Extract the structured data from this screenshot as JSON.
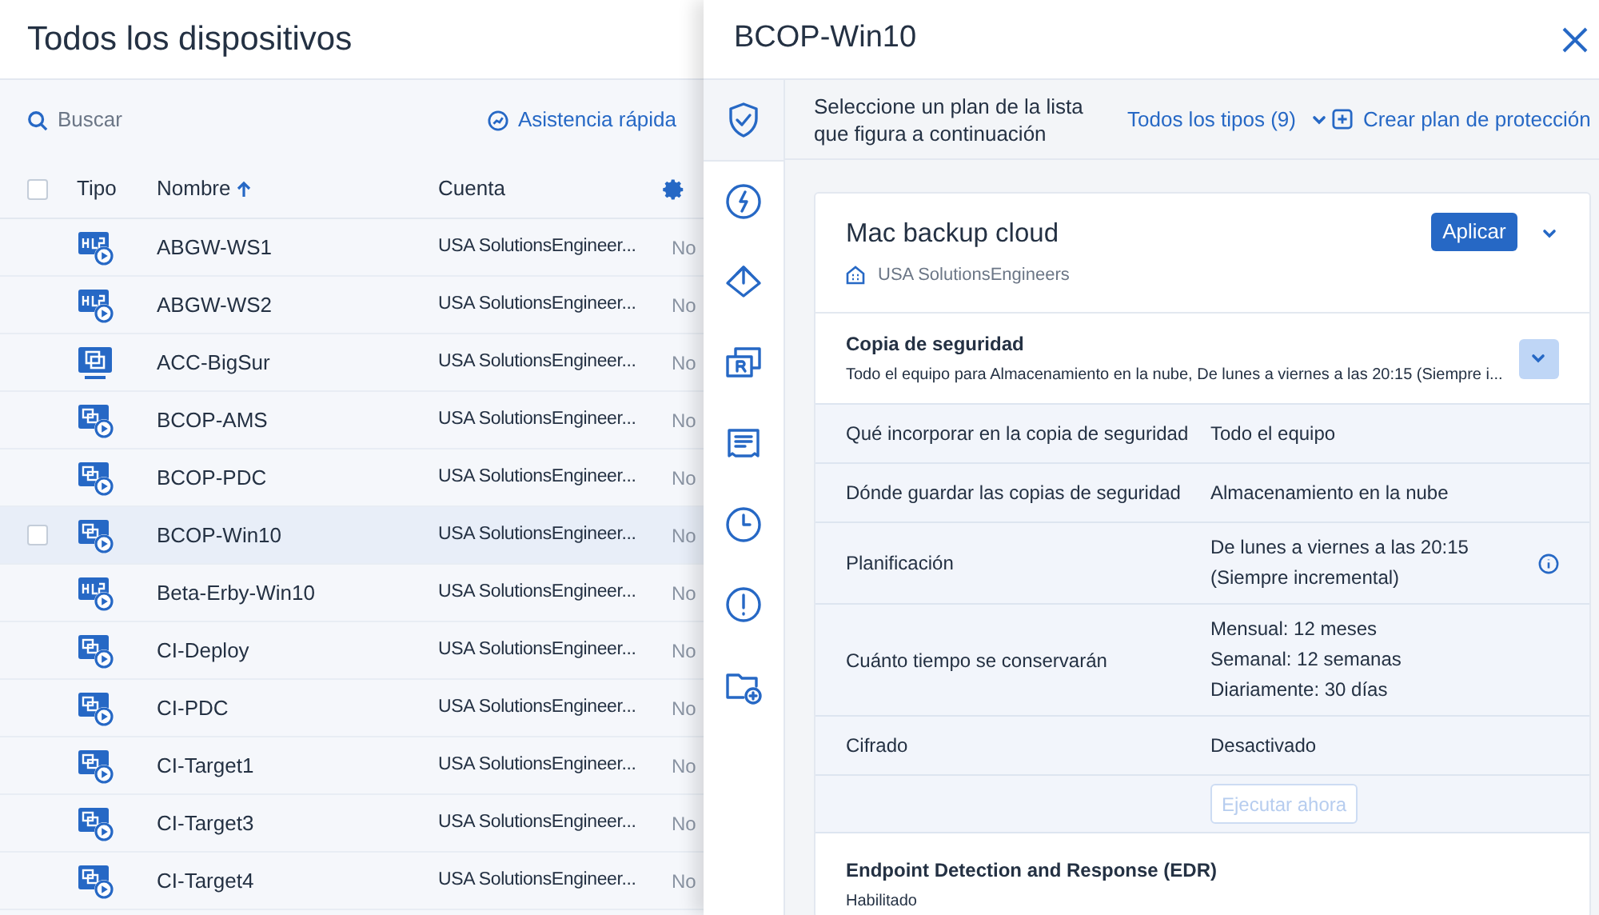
{
  "devices": {
    "title": "Todos los dispositivos",
    "search": {
      "placeholder": "Buscar"
    },
    "quick_assist": "Asistencia rápida",
    "table": {
      "select_all_checked": false,
      "columns": [
        {
          "label": "Tipo",
          "sorted": false
        },
        {
          "label": "Nombre",
          "sorted": true
        },
        {
          "label": "Cuenta",
          "sorted": false
        }
      ],
      "rows": [
        {
          "kind": "hc",
          "name": "ABGW-WS1",
          "account": "USA SolutionsEngineer...",
          "column_4": "No",
          "selected": false
        },
        {
          "kind": "hc",
          "name": "ABGW-WS2",
          "account": "USA SolutionsEngineer...",
          "column_4": "No",
          "selected": false
        },
        {
          "kind": "vm",
          "name": "ACC-BigSur",
          "account": "USA SolutionsEngineer...",
          "column_4": "No",
          "selected": false
        },
        {
          "kind": "multi",
          "name": "BCOP-AMS",
          "account": "USA SolutionsEngineer...",
          "column_4": "No",
          "selected": false
        },
        {
          "kind": "multi",
          "name": "BCOP-PDC",
          "account": "USA SolutionsEngineer...",
          "column_4": "No",
          "selected": false
        },
        {
          "kind": "multi",
          "name": "BCOP-Win10",
          "account": "USA SolutionsEngineer...",
          "column_4": "No",
          "selected": true
        },
        {
          "kind": "hc",
          "name": "Beta-Erby-Win10",
          "account": "USA SolutionsEngineer...",
          "column_4": "No",
          "selected": false
        },
        {
          "kind": "multi",
          "name": "CI-Deploy",
          "account": "USA SolutionsEngineer...",
          "column_4": "No",
          "selected": false
        },
        {
          "kind": "multi",
          "name": "CI-PDC",
          "account": "USA SolutionsEngineer...",
          "column_4": "No",
          "selected": false
        },
        {
          "kind": "multi",
          "name": "CI-Target1",
          "account": "USA SolutionsEngineer...",
          "column_4": "No",
          "selected": false
        },
        {
          "kind": "multi",
          "name": "CI-Target3",
          "account": "USA SolutionsEngineer...",
          "column_4": "No",
          "selected": false
        },
        {
          "kind": "multi",
          "name": "CI-Target4",
          "account": "USA SolutionsEngineer...",
          "column_4": "No",
          "selected": false
        }
      ]
    }
  },
  "panel": {
    "title": "BCOP-Win10",
    "nav": [
      {
        "kind": "shield",
        "selected": true
      },
      {
        "kind": "bolt",
        "selected": false
      },
      {
        "kind": "upload",
        "selected": false
      },
      {
        "kind": "replica",
        "selected": false
      },
      {
        "kind": "report",
        "selected": false
      },
      {
        "kind": "clock",
        "selected": false
      },
      {
        "kind": "alert",
        "selected": false
      },
      {
        "kind": "folder",
        "selected": false
      }
    ],
    "prompt": "Seleccione un plan de la lista que figura a continuación",
    "filter": "Todos los tipos (9)",
    "create": "Crear plan de protección",
    "plan": {
      "name": "Mac backup cloud",
      "apply": "Aplicar",
      "owner": "USA SolutionsEngineers",
      "sections": [
        {
          "title": "Copia de seguridad",
          "summary": "Todo el equipo para Almacenamiento en la nube, De lunes a viernes a las 20:15 (Siempre i...",
          "expanded": true,
          "settings": [
            {
              "label": "Qué incorporar en la copia de seguridad",
              "values": [
                "Todo el equipo"
              ],
              "info": false
            },
            {
              "label": "Dónde guardar las copias de seguridad",
              "values": [
                "Almacenamiento en la nube"
              ],
              "info": false
            },
            {
              "label": "Planificación",
              "values": [
                "De lunes a viernes a las 20:15",
                "(Siempre incremental)"
              ],
              "info": true
            },
            {
              "label": "Cuánto tiempo se conservarán",
              "values": [
                "Mensual: 12 meses",
                "Semanal: 12 semanas",
                "Diariamente: 30 días"
              ],
              "info": false
            },
            {
              "label": "Cifrado",
              "values": [
                "Desactivado"
              ],
              "info": false
            }
          ],
          "run_button": {
            "label": "Ejecutar ahora",
            "disabled": true
          }
        },
        {
          "title": "Endpoint Detection and Response (EDR)",
          "summary": "Habilitado"
        }
      ]
    }
  }
}
